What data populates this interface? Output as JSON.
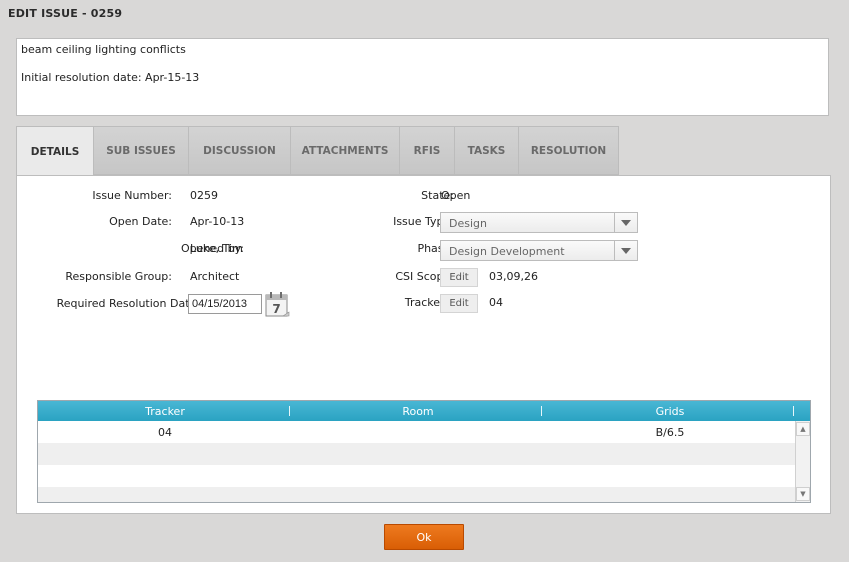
{
  "header": {
    "title": "EDIT ISSUE - 0259"
  },
  "description": {
    "line1": "beam ceiling lighting conflicts",
    "line2": "Initial resolution date: Apr-15-13"
  },
  "tabs": [
    {
      "label": "DETAILS",
      "active": true
    },
    {
      "label": "SUB ISSUES"
    },
    {
      "label": "DISCUSSION"
    },
    {
      "label": "ATTACHMENTS"
    },
    {
      "label": "RFIS"
    },
    {
      "label": "TASKS"
    },
    {
      "label": "RESOLUTION"
    }
  ],
  "details": {
    "issue_number": {
      "label": "Issue Number:",
      "value": "0259"
    },
    "open_date": {
      "label": "Open Date:",
      "value": "Apr-10-13"
    },
    "opened_by": {
      "label": "Opened by:",
      "value": "Luke, Tim"
    },
    "responsible_group": {
      "label": "Responsible Group:",
      "value": "Architect"
    },
    "required_resolution_date": {
      "label": "Required Resolution Date:",
      "value": "04/15/2013"
    },
    "state": {
      "label": "State:",
      "value": "Open"
    },
    "issue_type": {
      "label": "Issue Type:",
      "value": "Design"
    },
    "phase": {
      "label": "Phase:",
      "value": "Design Development"
    },
    "csi_scope": {
      "label": "CSI Scope:",
      "button": "Edit",
      "value": "03,09,26"
    },
    "trackers": {
      "label": "Trackers:",
      "button": "Edit",
      "value": "04"
    }
  },
  "calendar_icon_day": "7",
  "tracker_table": {
    "columns": [
      "Tracker",
      "Room",
      "Grids"
    ],
    "rows": [
      [
        "04",
        "",
        "B/6.5"
      ],
      [
        "",
        "",
        ""
      ],
      [
        "",
        "",
        ""
      ],
      [
        "",
        "",
        ""
      ]
    ]
  },
  "footer": {
    "ok_label": "Ok"
  },
  "colors": {
    "grid_header": "#2aa3c2",
    "ok_button": "#e06a10"
  }
}
